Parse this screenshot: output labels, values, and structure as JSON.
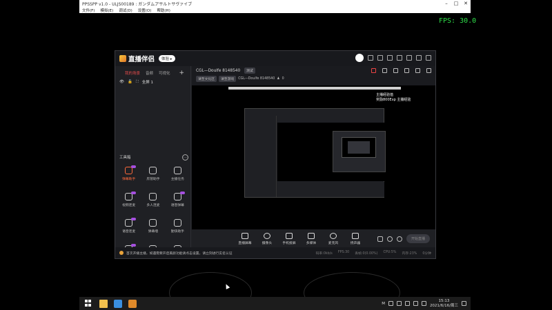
{
  "host": {
    "title": "PPSSPP v1.0 - ULJS00189 : ガンダムアサルトサヴァイブ",
    "menu": [
      "文件(F)",
      "模拟(E)",
      "调试(D)",
      "设置(O)",
      "帮助(H)"
    ],
    "fps": "FPS: 30.0"
  },
  "app": {
    "brand": "直播伴侣",
    "version_pill": "体验 ▸",
    "left_tabs": [
      "我的场景",
      "音频",
      "可视化"
    ],
    "scene_label": "全屏 1",
    "toolbox_title": "工具箱",
    "tools": [
      {
        "label": "弹幕助手",
        "hot": true,
        "badge": true
      },
      {
        "label": "房管助手",
        "hot": false,
        "badge": false
      },
      {
        "label": "主播任务",
        "hot": false,
        "badge": false
      },
      {
        "label": "视频连麦",
        "hot": false,
        "badge": true
      },
      {
        "label": "多人连麦",
        "hot": false,
        "badge": false
      },
      {
        "label": "语音弹幕",
        "hot": false,
        "badge": true
      },
      {
        "label": "语音连麦",
        "hot": false,
        "badge": true
      },
      {
        "label": "弹幕墙",
        "hot": false,
        "badge": false
      },
      {
        "label": "勤快助手",
        "hot": false,
        "badge": false
      },
      {
        "label": "",
        "hot": false,
        "badge": true
      },
      {
        "label": "",
        "hot": false,
        "badge": false
      },
      {
        "label": "",
        "hot": false,
        "badge": false
      }
    ],
    "room_title": "CGL—Doulfe 8148540",
    "room_pill": "测试",
    "sub_tags": [
      "请至文化区",
      "请至游戏"
    ],
    "sub_info": "CGL—Doulfe 8148540",
    "sub_count": "0",
    "overlay_lines": [
      "主播经验值",
      "奖励800Exp 主播经验"
    ],
    "dock": [
      "直播屏幕",
      "摄像头",
      "手机投屏",
      "多媒体",
      "麦克风",
      "扬声器"
    ],
    "start_label": "开始直播",
    "status_msg": "首次开播主播，如遇需要开启美颜功能请点击设置，请立刻进行实名认证",
    "stats": [
      "码率:0kb/s",
      "FPS:30",
      "丢帧:0(0.00%)",
      "CPU:5%",
      "内存:23%",
      "0分钟"
    ]
  },
  "taskbar": {
    "clock_time": "15:13",
    "clock_date": "2021/6/16/周三",
    "tray_text": "M"
  }
}
